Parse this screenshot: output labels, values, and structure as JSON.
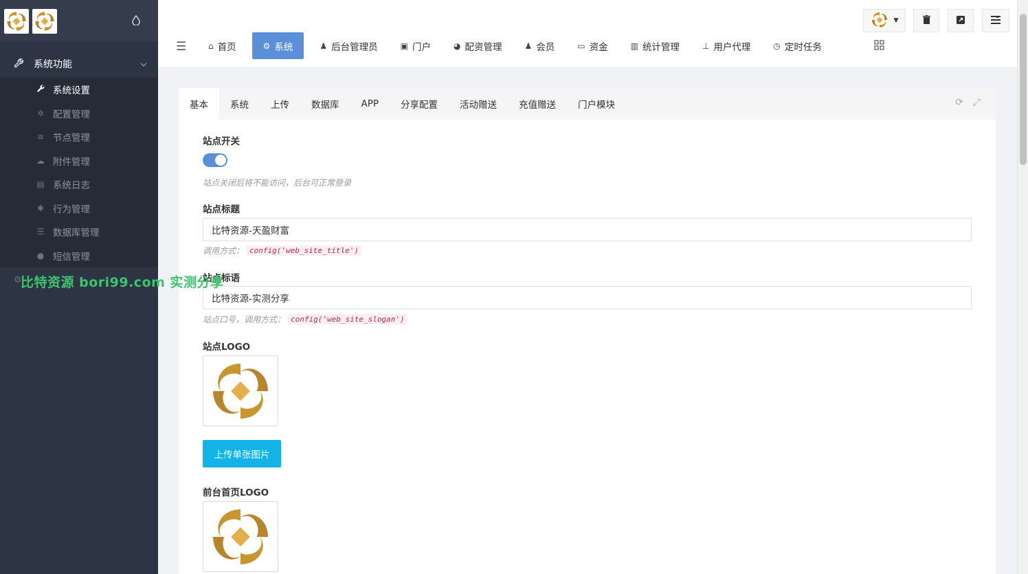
{
  "sidebar": {
    "logo_name": "",
    "section_title": "系统功能",
    "items": [
      {
        "label": "系统设置",
        "icon": "wrench-icon"
      },
      {
        "label": "配置管理",
        "icon": "gears-icon"
      },
      {
        "label": "节点管理",
        "icon": "list-icon"
      },
      {
        "label": "附件管理",
        "icon": "cloud-upload-icon"
      },
      {
        "label": "系统日志",
        "icon": "book-icon"
      },
      {
        "label": "行为管理",
        "icon": "bug-icon"
      },
      {
        "label": "数据库管理",
        "icon": "database-icon"
      },
      {
        "label": "短信管理",
        "icon": "comment-icon"
      }
    ]
  },
  "watermark": "比特资源 bori99.com 实测分享",
  "header": {
    "nav": [
      {
        "label": "首页",
        "icon": "home-icon"
      },
      {
        "label": "系统",
        "icon": "gear-icon"
      },
      {
        "label": "后台管理员",
        "icon": "user-icon"
      },
      {
        "label": "门户",
        "icon": "newspaper-icon"
      },
      {
        "label": "配资管理",
        "icon": "pie-chart-icon"
      },
      {
        "label": "会员",
        "icon": "users-icon"
      },
      {
        "label": "资金",
        "icon": "money-icon"
      },
      {
        "label": "统计管理",
        "icon": "bar-chart-icon"
      },
      {
        "label": "用户代理",
        "icon": "sitemap-icon"
      },
      {
        "label": "定时任务",
        "icon": "clock-icon"
      }
    ],
    "active_nav": "系统",
    "accent_color": "#5b8fd8"
  },
  "tabs": [
    "基本",
    "系统",
    "上传",
    "数据库",
    "APP",
    "分享配置",
    "活动赠送",
    "充值赠送",
    "门户模块"
  ],
  "form": {
    "site_switch": {
      "label": "站点开关",
      "help": "站点关闭后将不能访问，后台可正常登录",
      "on": true
    },
    "site_title": {
      "label": "站点标题",
      "value": "比特资源-天盈财富",
      "help_prefix": "调用方式：",
      "code": "config('web_site_title')"
    },
    "site_slogan": {
      "label": "站点标语",
      "value": "比特资源-实测分享",
      "help_prefix": "站点口号，调用方式：",
      "code": "config('web_site_slogan')"
    },
    "site_logo": {
      "label": "站点LOGO"
    },
    "upload_button": "上传单张图片",
    "front_logo": {
      "label": "前台首页LOGO"
    }
  }
}
